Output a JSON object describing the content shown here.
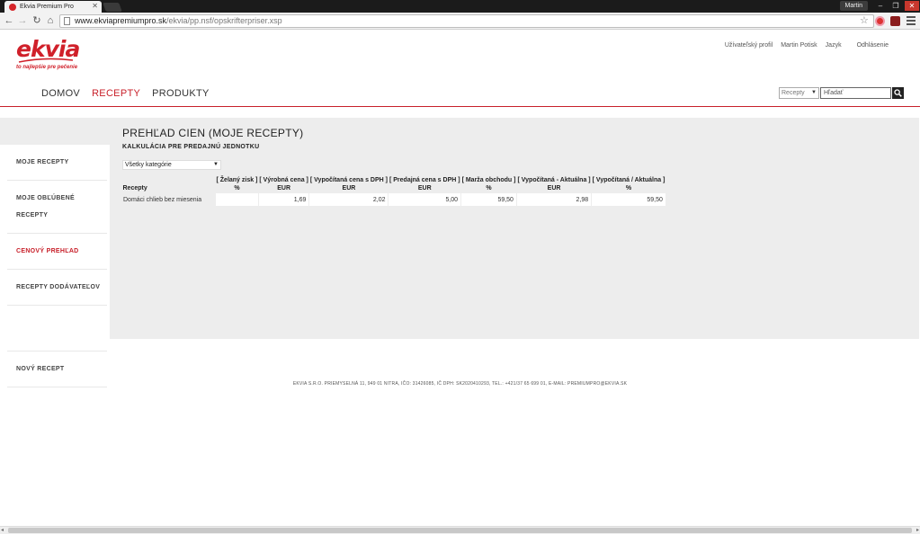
{
  "browser": {
    "tab_title": "Ekvia Premium Pro",
    "profile_name": "Martin",
    "url_host": "www.ekviapremiumpro.sk",
    "url_path": "/ekvia/pp.nsf/opskrifterpriser.xsp"
  },
  "header": {
    "logo_text": "ekvia",
    "logo_tagline": "to najlepšie pre pečenie",
    "links": [
      "Užívateľský profil",
      "Martin Potisk",
      "Jazyk",
      "Odhlásenie"
    ],
    "nav": [
      {
        "label": "DOMOV",
        "active": false
      },
      {
        "label": "RECEPTY",
        "active": true
      },
      {
        "label": "PRODUKTY",
        "active": false
      }
    ],
    "search_scope": "Recepty",
    "search_placeholder": "Hľadať"
  },
  "sidebar": {
    "items": [
      {
        "label": "MOJE RECEPTY",
        "active": false
      },
      {
        "label": "MOJE OBĽÚBENÉ RECEPTY",
        "active": false
      },
      {
        "label": "CENOVÝ PREHĽAD",
        "active": true
      },
      {
        "label": "RECEPTY DODÁVATEĽOV",
        "active": false
      }
    ],
    "bottom_item": "NOVÝ RECEPT"
  },
  "content": {
    "title": "PREHĽAD CIEN (MOJE RECEPTY)",
    "subtitle": "KALKULÁCIA PRE PREDAJNÚ JEDNOTKU",
    "category_filter": "Všetky kategórie",
    "table": {
      "first_column": "Recepty",
      "columns": [
        {
          "label": "[ Želaný zisk ]",
          "unit": "%"
        },
        {
          "label": "[ Výrobná cena ]",
          "unit": "EUR"
        },
        {
          "label": "[ Vypočítaná cena s DPH ]",
          "unit": "EUR"
        },
        {
          "label": "[ Predajná cena s DPH ]",
          "unit": "EUR"
        },
        {
          "label": "[ Marža obchodu ]",
          "unit": "%"
        },
        {
          "label": "[ Vypočítaná - Aktuálna ]",
          "unit": "EUR"
        },
        {
          "label": "[ Vypočítaná / Aktuálna ]",
          "unit": "%"
        }
      ],
      "rows": [
        {
          "name": "Domáci chlieb bez miesenia",
          "values": [
            "",
            "1,69",
            "2,02",
            "5,00",
            "59,50",
            "2,98",
            "59,50"
          ]
        }
      ]
    }
  },
  "footer": {
    "text": "EKVIA S.R.O. PRIEMYSELNÁ 11, 949 01 NITRA, IČO: 31426085, IČ DPH: SK2020410293, TEL.: +421/37 65 699 01, E-MAIL: PREMIUMPRO@EKVIA.SK"
  },
  "colors": {
    "brand_red": "#c8202a",
    "panel_gray": "#ededed"
  }
}
